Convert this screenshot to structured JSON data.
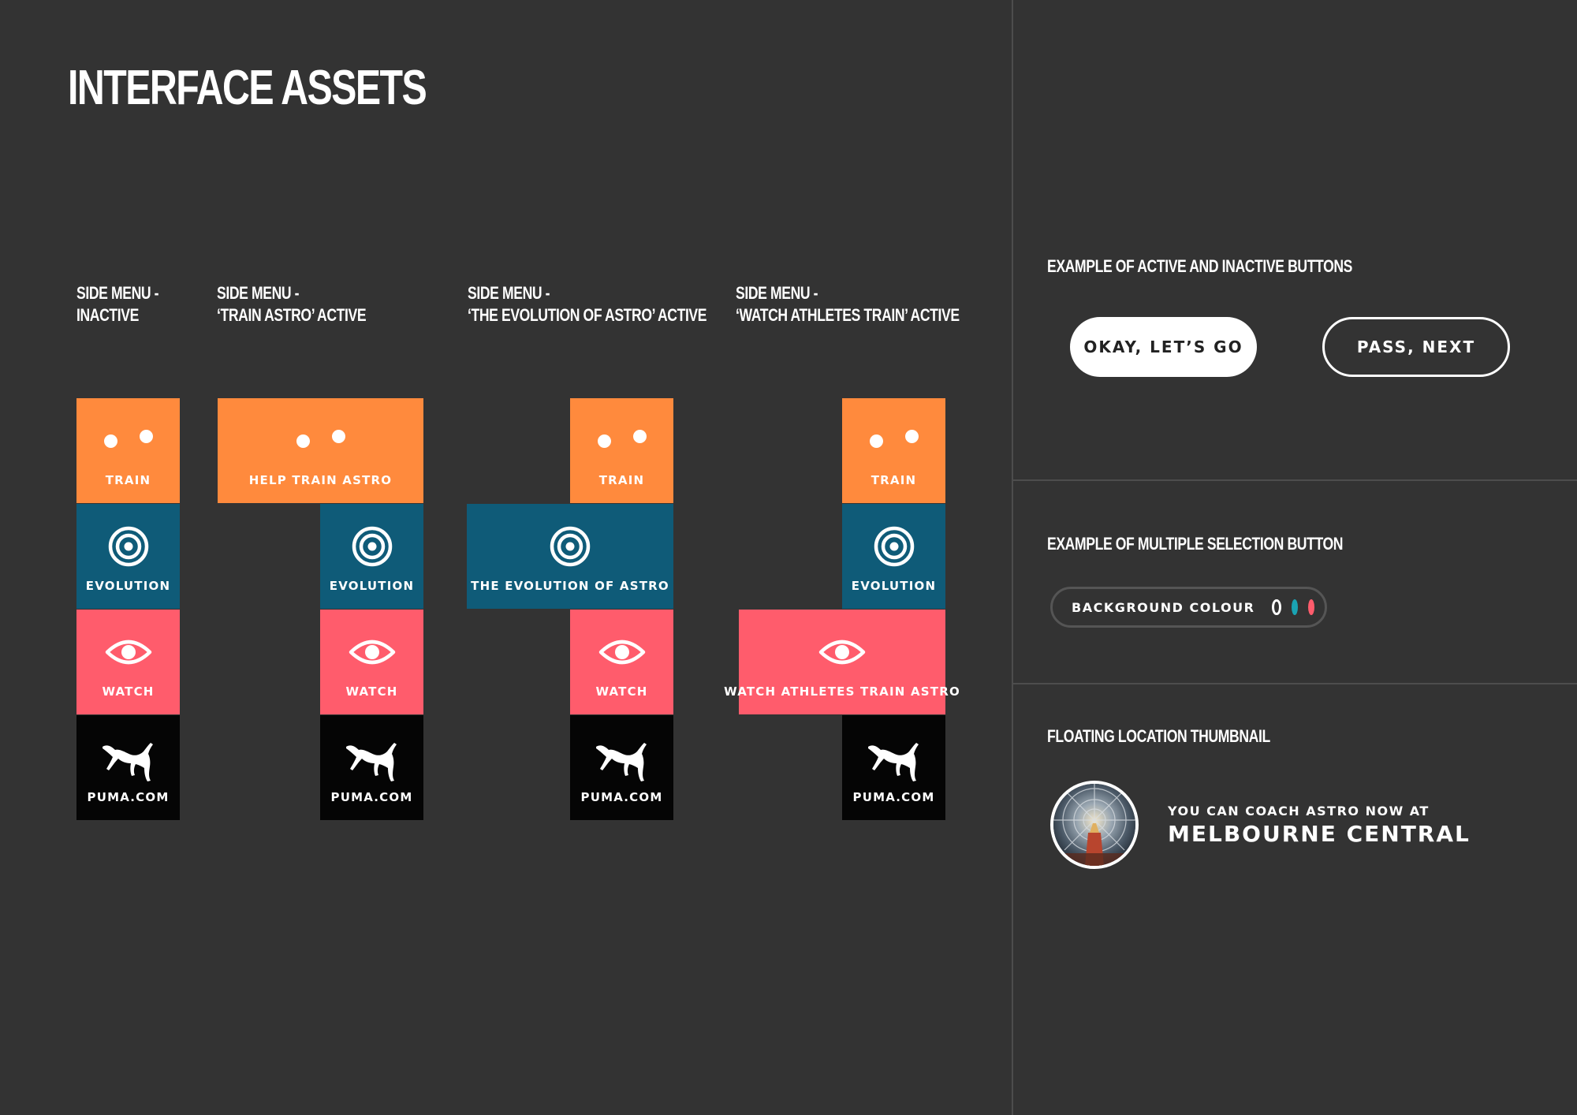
{
  "page": {
    "title": "INTERFACE ASSETS"
  },
  "side_menu": {
    "columns": [
      {
        "heading_line1": "SIDE MENU -",
        "heading_line2": "INACTIVE"
      },
      {
        "heading_line1": "SIDE MENU -",
        "heading_line2": "‘TRAIN ASTRO’ ACTIVE"
      },
      {
        "heading_line1": "SIDE MENU -",
        "heading_line2": "‘THE EVOLUTION OF ASTRO’ ACTIVE"
      },
      {
        "heading_line1": "SIDE MENU -",
        "heading_line2": "‘WATCH ATHLETES TRAIN’ ACTIVE"
      }
    ],
    "labels": {
      "train": "TRAIN",
      "train_active": "HELP TRAIN ASTRO",
      "evolution": "EVOLUTION",
      "evolution_active": "THE EVOLUTION OF ASTRO",
      "watch": "WATCH",
      "watch_active": "WATCH ATHLETES TRAIN ASTRO",
      "puma": "PUMA.COM"
    },
    "icons": [
      "face-icon",
      "target-icon",
      "eye-icon",
      "puma-logo-icon"
    ],
    "colors": {
      "train": "#ff8a3d",
      "evolution": "#0f5b78",
      "watch": "#ff5c6c",
      "puma": "#050505"
    }
  },
  "buttons_example": {
    "heading": "EXAMPLE OF ACTIVE AND INACTIVE BUTTONS",
    "active_label": "OKAY, LET’S GO",
    "inactive_label": "PASS, NEXT"
  },
  "multi_select_example": {
    "heading": "EXAMPLE OF MULTIPLE SELECTION BUTTON",
    "label": "BACKGROUND COLOUR",
    "swatches": [
      "#333333",
      "#1aa3b3",
      "#ff5c6c"
    ]
  },
  "location_example": {
    "heading": "FLOATING LOCATION THUMBNAIL",
    "subtitle": "YOU CAN COACH ASTRO NOW AT",
    "location": "MELBOURNE CENTRAL"
  }
}
